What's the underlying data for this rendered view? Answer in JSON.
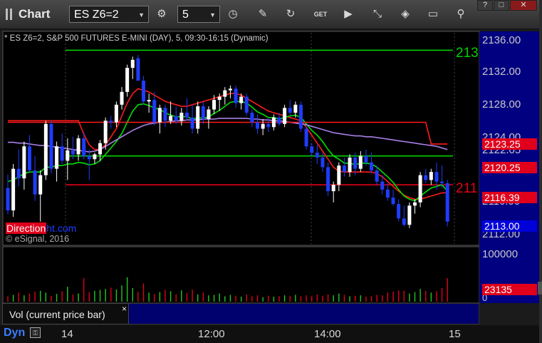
{
  "app": {
    "title": "Chart"
  },
  "toolbar": {
    "symbol": "ES Z6=2",
    "interval": "5",
    "icons": [
      "settings-gear-icon",
      "clock-icon",
      "pencil-icon",
      "refresh-icon",
      "get-icon",
      "play-icon",
      "link-icon",
      "comment-icon",
      "pin-icon"
    ]
  },
  "window_buttons": {
    "help": "?",
    "restore": "□",
    "close": "✕"
  },
  "chart_header": "* ES Z6=2, S&P 500 FUTURES E-MINI (DAY), 5, 09:30-16:15 (Dynamic)",
  "brand": {
    "part_a": "Direction",
    "part_b": "ht.com"
  },
  "copyright": "© eSignal, 2016",
  "axis": {
    "price_ticks": [
      "2136.00",
      "2132.00",
      "2128.00",
      "2124.00",
      "2122.05",
      "2116.00",
      "2112.00"
    ],
    "volume_ticks": [
      "100000",
      "0"
    ],
    "time_ticks": [
      "14",
      "12:00",
      "14:00",
      "15"
    ]
  },
  "price_labels": [
    {
      "text": "2123.25",
      "color": "#e0001b"
    },
    {
      "text": "2120.25",
      "color": "#e0001b"
    },
    {
      "text": "2116.39",
      "color": "#e0001b"
    },
    {
      "text": "2113.00",
      "color": "#0000d8"
    }
  ],
  "line_tags": {
    "green": "213",
    "red": "211"
  },
  "volume": {
    "label": "Vol (current price bar)",
    "close": "×",
    "current_value": "23135",
    "current_value_color": "#e0001b"
  },
  "bottom_bar": {
    "layout_name": "Dyn"
  },
  "chart_data": {
    "type": "candlestick",
    "price_range": [
      2111,
      2137
    ],
    "volume_range": [
      0,
      115000
    ],
    "horizontal_levels": [
      {
        "value": 2135.0,
        "color": "#00d000"
      },
      {
        "value": 2121.8,
        "color": "#00d000"
      },
      {
        "value": 2118.2,
        "color": "#e0001b"
      }
    ],
    "candles": [
      [
        2117.8,
        2119.5,
        2114.5,
        2115.0
      ],
      [
        2115.0,
        2120.8,
        2114.2,
        2120.2
      ],
      [
        2120.2,
        2122.6,
        2118.0,
        2119.0
      ],
      [
        2119.0,
        2123.6,
        2117.6,
        2123.0
      ],
      [
        2123.0,
        2124.4,
        2119.8,
        2120.0
      ],
      [
        2120.0,
        2121.8,
        2116.2,
        2117.0
      ],
      [
        2117.0,
        2120.0,
        2113.6,
        2119.4
      ],
      [
        2119.4,
        2126.2,
        2118.8,
        2125.8
      ],
      [
        2125.8,
        2126.2,
        2119.6,
        2120.2
      ],
      [
        2120.2,
        2123.6,
        2118.6,
        2123.0
      ],
      [
        2123.0,
        2124.6,
        2120.8,
        2121.2
      ],
      [
        2121.2,
        2124.0,
        2118.8,
        2122.5
      ],
      [
        2122.5,
        2124.2,
        2121.4,
        2122.0
      ],
      [
        2122.0,
        2124.4,
        2121.2,
        2124.0
      ],
      [
        2124.0,
        2124.8,
        2121.4,
        2121.8
      ],
      [
        2121.8,
        2122.6,
        2118.8,
        2121.4
      ],
      [
        2121.4,
        2122.2,
        2120.8,
        2122.0
      ],
      [
        2122.0,
        2123.8,
        2121.2,
        2123.4
      ],
      [
        2123.4,
        2126.6,
        2122.6,
        2126.2
      ],
      [
        2126.2,
        2126.8,
        2125.2,
        2126.0
      ],
      [
        2126.0,
        2128.6,
        2125.4,
        2128.2
      ],
      [
        2128.2,
        2130.4,
        2127.6,
        2129.8
      ],
      [
        2129.8,
        2133.2,
        2129.2,
        2132.8
      ],
      [
        2132.8,
        2134.2,
        2131.4,
        2133.8
      ],
      [
        2134.0,
        2134.4,
        2131.6,
        2131.2
      ],
      [
        2131.2,
        2131.8,
        2128.2,
        2128.6
      ],
      [
        2128.6,
        2129.6,
        2127.2,
        2128.8
      ],
      [
        2128.8,
        2129.8,
        2125.6,
        2126.0
      ],
      [
        2126.0,
        2128.2,
        2124.6,
        2127.8
      ],
      [
        2127.8,
        2128.2,
        2125.4,
        2126.2
      ],
      [
        2126.2,
        2128.6,
        2125.8,
        2126.8
      ],
      [
        2126.8,
        2128.0,
        2125.8,
        2126.2
      ],
      [
        2126.2,
        2127.8,
        2125.6,
        2127.2
      ],
      [
        2127.2,
        2129.0,
        2126.2,
        2126.6
      ],
      [
        2126.6,
        2128.2,
        2124.6,
        2125.2
      ],
      [
        2125.2,
        2128.6,
        2124.6,
        2128.0
      ],
      [
        2128.0,
        2128.6,
        2125.8,
        2126.4
      ],
      [
        2126.4,
        2128.0,
        2125.2,
        2127.6
      ],
      [
        2127.6,
        2129.4,
        2127.0,
        2128.8
      ],
      [
        2128.8,
        2129.6,
        2127.4,
        2129.2
      ],
      [
        2129.2,
        2130.4,
        2128.2,
        2130.0
      ],
      [
        2130.0,
        2130.6,
        2129.0,
        2130.2
      ],
      [
        2130.2,
        2130.6,
        2127.8,
        2128.4
      ],
      [
        2128.4,
        2129.6,
        2127.6,
        2129.2
      ],
      [
        2129.2,
        2129.6,
        2126.8,
        2127.2
      ],
      [
        2127.2,
        2127.6,
        2125.4,
        2126.0
      ],
      [
        2126.0,
        2127.0,
        2124.6,
        2125.2
      ],
      [
        2125.2,
        2126.4,
        2124.4,
        2125.8
      ],
      [
        2125.8,
        2126.6,
        2124.8,
        2125.4
      ],
      [
        2125.4,
        2127.0,
        2125.0,
        2126.6
      ],
      [
        2126.6,
        2127.2,
        2125.6,
        2125.8
      ],
      [
        2125.8,
        2128.2,
        2125.4,
        2127.8
      ],
      [
        2127.8,
        2128.8,
        2126.8,
        2127.2
      ],
      [
        2127.2,
        2128.6,
        2126.6,
        2128.2
      ],
      [
        2128.2,
        2128.6,
        2124.8,
        2125.2
      ],
      [
        2125.2,
        2125.6,
        2122.6,
        2123.0
      ],
      [
        2123.0,
        2123.4,
        2121.8,
        2122.2
      ],
      [
        2122.2,
        2123.2,
        2120.8,
        2121.6
      ],
      [
        2121.6,
        2122.2,
        2119.8,
        2120.4
      ],
      [
        2120.4,
        2121.0,
        2116.8,
        2117.4
      ],
      [
        2117.4,
        2118.6,
        2116.0,
        2118.2
      ],
      [
        2118.2,
        2121.0,
        2117.4,
        2120.6
      ],
      [
        2120.6,
        2121.6,
        2119.2,
        2119.8
      ],
      [
        2119.8,
        2122.0,
        2119.2,
        2121.6
      ],
      [
        2121.6,
        2122.2,
        2119.4,
        2120.2
      ],
      [
        2120.2,
        2122.4,
        2119.8,
        2121.8
      ],
      [
        2121.8,
        2122.6,
        2120.6,
        2121.0
      ],
      [
        2121.0,
        2122.2,
        2119.6,
        2120.0
      ],
      [
        2120.0,
        2120.6,
        2118.2,
        2118.6
      ],
      [
        2118.6,
        2119.4,
        2117.0,
        2117.6
      ],
      [
        2117.6,
        2118.4,
        2116.2,
        2116.6
      ],
      [
        2116.6,
        2117.6,
        2115.6,
        2115.8
      ],
      [
        2115.8,
        2116.4,
        2113.6,
        2114.0
      ],
      [
        2114.0,
        2115.6,
        2113.0,
        2113.2
      ],
      [
        2113.2,
        2116.0,
        2112.8,
        2115.6
      ],
      [
        2115.6,
        2116.4,
        2114.6,
        2116.0
      ],
      [
        2116.0,
        2119.8,
        2115.4,
        2119.4
      ],
      [
        2119.4,
        2120.2,
        2118.4,
        2118.8
      ],
      [
        2118.8,
        2120.2,
        2118.2,
        2119.8
      ],
      [
        2119.8,
        2121.0,
        2117.6,
        2118.6
      ],
      [
        2118.6,
        2120.6,
        2117.8,
        2118.4
      ],
      [
        2118.4,
        2118.8,
        2113.0,
        2113.6
      ]
    ],
    "volume_values": [
      12000,
      15000,
      20000,
      14000,
      18000,
      22000,
      24000,
      20000,
      13000,
      17000,
      23000,
      33000,
      16000,
      18000,
      52000,
      21000,
      24000,
      26000,
      28000,
      31000,
      27000,
      36000,
      54000,
      30000,
      22000,
      40000,
      20000,
      17000,
      21000,
      26000,
      23000,
      16000,
      25000,
      19000,
      27000,
      16000,
      20000,
      14000,
      15000,
      18000,
      12000,
      15000,
      13000,
      11000,
      16000,
      12000,
      14000,
      10000,
      13000,
      11000,
      12000,
      14000,
      13000,
      15000,
      12000,
      14000,
      12000,
      16000,
      13000,
      16000,
      14000,
      18000,
      15000,
      12000,
      13000,
      14000,
      11000,
      12000,
      15000,
      14000,
      20000,
      22000,
      25000,
      24000,
      18000,
      21000,
      28000,
      24000,
      20000,
      23000,
      30000,
      52000
    ],
    "series": [
      {
        "color": "#ff1a1a",
        "values": [
          2126.2,
          2126.2,
          2126.2,
          2126.2,
          2126.2,
          2126.2,
          2126.2,
          2126.2,
          2126.2,
          2126.2,
          2126.2,
          2126.2,
          2126.2,
          2126.2,
          2124.5,
          2123.2,
          2122.6,
          2122.6,
          2123.2,
          2124.2,
          2125.2,
          2126.8,
          2128.4,
          2129.6,
          2130.2,
          2130.0,
          2129.8,
          2129.4,
          2129.0,
          2128.6,
          2128.4,
          2128.2,
          2128.0,
          2128.0,
          2128.2,
          2128.4,
          2128.6,
          2128.8,
          2129.0,
          2129.2,
          2129.4,
          2129.6,
          2129.6,
          2129.4,
          2129.0,
          2128.6,
          2128.2,
          2127.8,
          2127.4,
          2127.2,
          2127.0,
          2126.8,
          2126.6,
          2126.4,
          2126.2,
          2125.4,
          2124.4,
          2123.4,
          2122.4,
          2121.4,
          2120.4,
          2119.9,
          2119.8,
          2119.8,
          2119.8,
          2119.8,
          2119.8,
          2119.8,
          2119.6,
          2119.2,
          2118.6,
          2118.0,
          2117.4,
          2116.9,
          2116.6,
          2116.4,
          2116.4,
          2116.6,
          2116.8,
          2117.0,
          2117.2,
          2117.2
        ]
      },
      {
        "color": "#00e000",
        "values": [
          2118.6,
          2118.8,
          2119.2,
          2119.6,
          2119.8,
          2119.8,
          2119.8,
          2120.4,
          2120.4,
          2120.6,
          2120.6,
          2120.8,
          2120.8,
          2121.0,
          2120.9,
          2120.7,
          2120.8,
          2121.2,
          2122.0,
          2122.8,
          2123.6,
          2124.6,
          2126.0,
          2127.4,
          2128.2,
          2128.3,
          2128.1,
          2127.8,
          2127.6,
          2127.2,
          2126.9,
          2126.7,
          2126.7,
          2126.7,
          2126.4,
          2126.6,
          2126.5,
          2126.7,
          2127.1,
          2127.5,
          2128.0,
          2128.5,
          2128.6,
          2128.6,
          2128.4,
          2127.9,
          2127.3,
          2127.0,
          2126.6,
          2126.6,
          2126.4,
          2126.6,
          2126.8,
          2126.9,
          2126.6,
          2125.8,
          2125.0,
          2124.4,
          2123.6,
          2122.6,
          2121.8,
          2121.4,
          2120.9,
          2120.9,
          2120.7,
          2120.9,
          2120.9,
          2120.8,
          2120.4,
          2119.8,
          2119.2,
          2118.5,
          2117.6,
          2116.8,
          2116.4,
          2116.2,
          2116.8,
          2117.3,
          2117.8,
          2118.0,
          2118.2,
          2117.4
        ]
      },
      {
        "color": "#a980e6",
        "values": [
          2123.5,
          2123.5,
          2123.4,
          2123.4,
          2123.3,
          2123.2,
          2123.1,
          2123.1,
          2123.0,
          2122.9,
          2122.8,
          2122.7,
          2122.6,
          2122.5,
          2122.4,
          2122.3,
          2122.4,
          2122.6,
          2123.0,
          2123.4,
          2123.8,
          2124.2,
          2124.6,
          2125.0,
          2125.3,
          2125.6,
          2125.8,
          2125.9,
          2126.0,
          2126.0,
          2126.1,
          2126.2,
          2126.2,
          2126.3,
          2126.3,
          2126.3,
          2126.4,
          2126.4,
          2126.4,
          2126.5,
          2126.5,
          2126.5,
          2126.5,
          2126.5,
          2126.5,
          2126.4,
          2126.4,
          2126.3,
          2126.3,
          2126.2,
          2126.2,
          2126.1,
          2126.0,
          2125.9,
          2125.8,
          2125.7,
          2125.5,
          2125.3,
          2125.1,
          2124.9,
          2124.7,
          2124.6,
          2124.5,
          2124.4,
          2124.3,
          2124.3,
          2124.2,
          2124.2,
          2124.1,
          2124.0,
          2123.9,
          2123.8,
          2123.7,
          2123.6,
          2123.5,
          2123.4,
          2123.3,
          2123.2,
          2123.1,
          2123.0,
          2122.8,
          2122.6
        ]
      },
      {
        "color": "#ff1a1a",
        "values": [
          2126.0,
          2126.0,
          2126.0,
          2126.0,
          2126.0,
          2126.0,
          2126.0,
          2126.0,
          2126.0,
          2126.0,
          2126.0,
          2126.0,
          2126.0,
          2126.0,
          2126.0,
          2126.0,
          2126.0,
          2126.0,
          2126.0,
          2126.0,
          2126.0,
          2126.0,
          2126.0,
          2126.0,
          2126.0,
          2126.0,
          2126.0,
          2126.0,
          2126.0,
          2126.0,
          2126.0,
          2126.0,
          2126.0,
          2126.0,
          2126.0,
          2126.0,
          2126.0,
          2126.0,
          2126.0,
          2126.0,
          2126.0,
          2126.0,
          2126.0,
          2126.0,
          2126.0,
          2126.0,
          2126.0,
          2126.0,
          2126.0,
          2126.0,
          2126.0,
          2126.0,
          2126.0,
          2126.0,
          2126.0,
          2126.0,
          2126.0,
          2126.0,
          2126.0,
          2126.0,
          2126.0,
          2126.0,
          2126.0,
          2126.0,
          2126.0,
          2126.0,
          2126.0,
          2126.0,
          2126.0,
          2126.0,
          2126.0,
          2126.0,
          2126.0,
          2126.0,
          2126.0,
          2126.0,
          2126.0,
          2126.0,
          2123.3,
          2123.3,
          2123.3,
          2123.3
        ]
      }
    ]
  }
}
